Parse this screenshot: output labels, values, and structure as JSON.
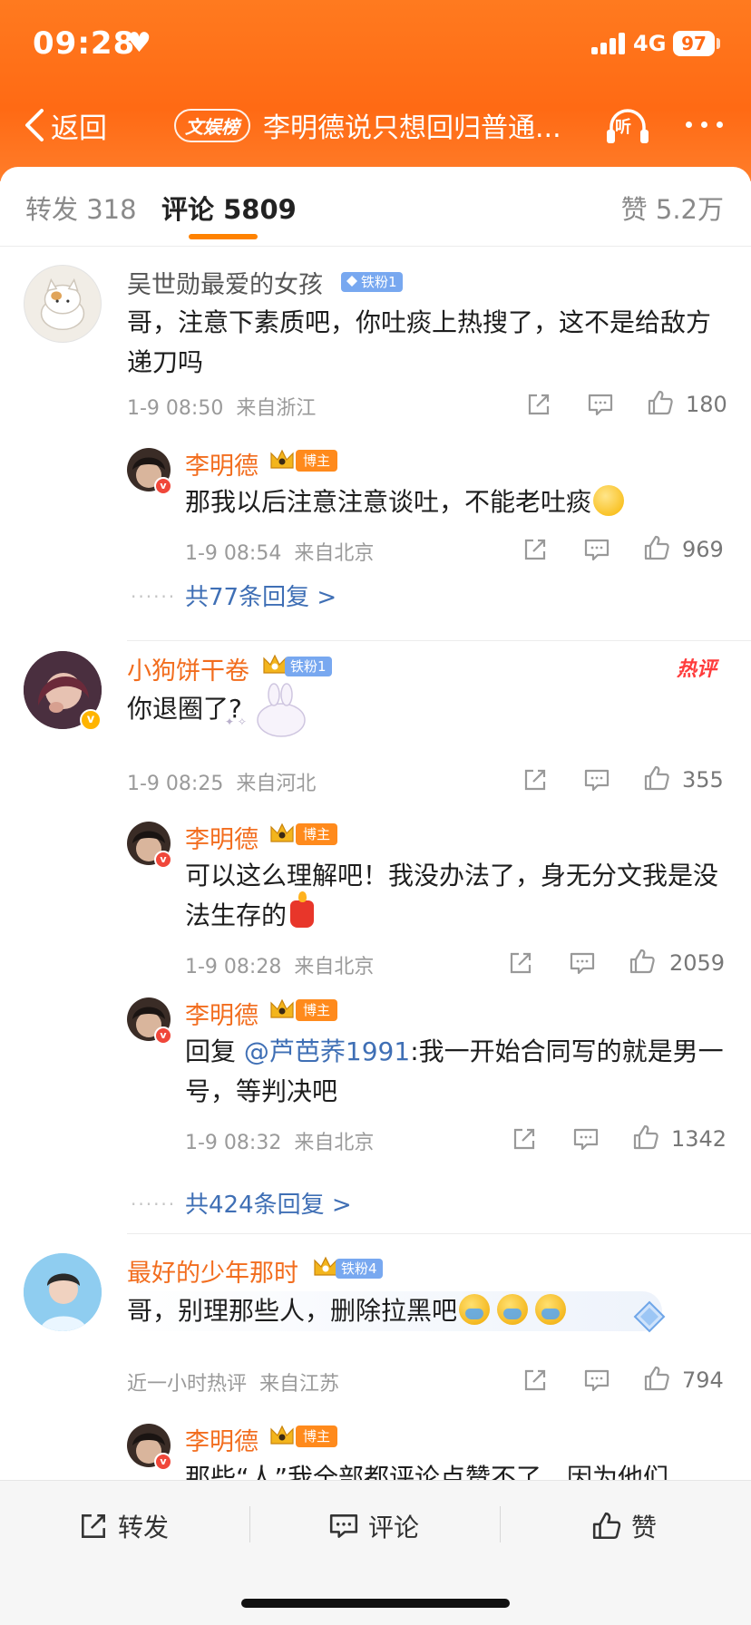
{
  "status": {
    "time": "09:28",
    "network": "4G",
    "battery": "97"
  },
  "nav": {
    "back_label": "返回",
    "badge": "文娱榜",
    "title": "李明德说只想回归普通...",
    "listen_label": "听"
  },
  "tabs": {
    "repost": "转发 318",
    "comment": "评论 5809",
    "like": "赞 5.2万"
  },
  "comments": [
    {
      "user": "吴世勋最爱的女孩",
      "badge": "铁粉1",
      "text": "哥，注意下素质吧，你吐痰上热搜了，这不是给敌方递刀吗",
      "time": "1-9 08:50",
      "location": "来自浙江",
      "likes": "180",
      "replies": [
        {
          "user": "李明德",
          "badge": "博主",
          "text": "那我以后注意注意谈吐，不能老吐痰",
          "time": "1-9 08:54",
          "location": "来自北京",
          "likes": "969"
        }
      ],
      "more_replies": "共77条回复 >"
    },
    {
      "user": "小狗饼干卷",
      "badge": "铁粉1",
      "hot_tag": "热评",
      "text": "你退圈了?",
      "time": "1-9 08:25",
      "location": "来自河北",
      "likes": "355",
      "replies": [
        {
          "user": "李明德",
          "badge": "博主",
          "text": "可以这么理解吧！我没办法了，身无分文我是没法生存的",
          "time": "1-9 08:28",
          "location": "来自北京",
          "likes": "2059"
        },
        {
          "user": "李明德",
          "badge": "博主",
          "reply_prefix": "回复",
          "mention": "@芦芭荞1991",
          "text": ":我一开始合同写的就是男一号，等判决吧",
          "time": "1-9 08:32",
          "location": "来自北京",
          "likes": "1342"
        }
      ],
      "more_replies": "共424条回复 >"
    },
    {
      "user": "最好的少年那时",
      "badge": "铁粉4",
      "text": "哥，别理那些人，删除拉黑吧",
      "time": "近一小时热评",
      "location": "来自江苏",
      "likes": "794",
      "replies": [
        {
          "user": "李明德",
          "badge": "博主",
          "text": "那些“人”我全部都评论点赞不了，因为他们"
        }
      ]
    }
  ],
  "toolbar": {
    "repost": "转发",
    "comment": "评论",
    "like": "赞"
  },
  "colors": {
    "brand": "#ff6a14",
    "accent": "#ff8200",
    "link": "#3f6fb5",
    "host_name": "#f26d1e"
  }
}
